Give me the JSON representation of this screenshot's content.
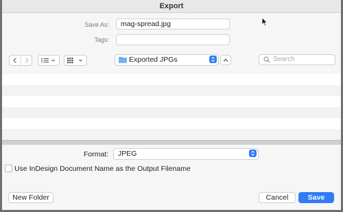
{
  "window": {
    "title": "Export"
  },
  "save_as": {
    "label": "Save As:",
    "value": "mag-spread.jpg"
  },
  "tags": {
    "label": "Tags:",
    "value": ""
  },
  "location": {
    "folder_name": "Exported JPGs",
    "folder_color": "#5aa3e8"
  },
  "search": {
    "placeholder": "Search"
  },
  "format": {
    "label": "Format:",
    "value": "JPEG"
  },
  "options": {
    "use_doc_name_label": "Use InDesign Document Name as the Output Filename",
    "use_doc_name_checked": false
  },
  "buttons": {
    "new_folder": "New Folder",
    "cancel": "Cancel",
    "save": "Save"
  },
  "colors": {
    "accent": "#2f7cf6"
  }
}
